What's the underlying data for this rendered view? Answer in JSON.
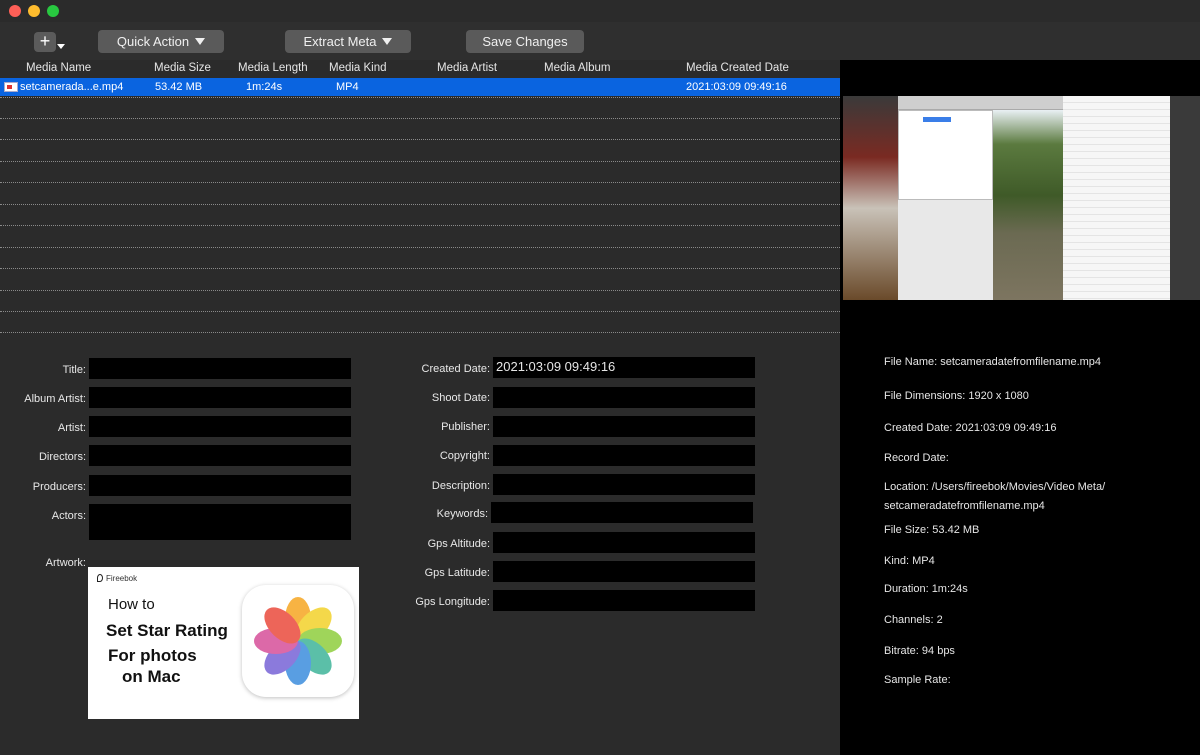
{
  "toolbar": {
    "add_label": "+",
    "quick_action": "Quick Action",
    "extract_meta": "Extract Meta",
    "save_changes": "Save Changes"
  },
  "table": {
    "headers": [
      "Media Name",
      "Media Size",
      "Media Length",
      "Media Kind",
      "Media Artist",
      "Media Album",
      "Media Created Date"
    ],
    "rows": [
      {
        "name": "setcamerada...e.mp4",
        "size": "53.42 MB",
        "length": "1m:24s",
        "kind": "MP4",
        "artist": "",
        "album": "",
        "created": "2021:03:09 09:49:16"
      }
    ]
  },
  "form": {
    "left": [
      {
        "label": "Title:",
        "value": ""
      },
      {
        "label": "Album Artist:",
        "value": ""
      },
      {
        "label": "Artist:",
        "value": ""
      },
      {
        "label": "Directors:",
        "value": ""
      },
      {
        "label": "Producers:",
        "value": ""
      },
      {
        "label": "Actors:",
        "value": ""
      },
      {
        "label": "Artwork:",
        "value": ""
      }
    ],
    "right": [
      {
        "label": "Created Date:",
        "value": "2021:03:09 09:49:16"
      },
      {
        "label": "Shoot Date:",
        "value": ""
      },
      {
        "label": "Publisher:",
        "value": ""
      },
      {
        "label": "Copyright:",
        "value": ""
      },
      {
        "label": "Description:",
        "value": ""
      },
      {
        "label": "Keywords:",
        "value": ""
      },
      {
        "label": "Gps Altitude:",
        "value": ""
      },
      {
        "label": "Gps Latitude:",
        "value": ""
      },
      {
        "label": "Gps Longitude:",
        "value": ""
      }
    ]
  },
  "artwork": {
    "brand": "Fireebok",
    "line_how": "How to",
    "line1": "Set Star Rating",
    "line2": "For photos",
    "line3": "on Mac"
  },
  "info": {
    "file_name": "File Name: setcameradatefromfilename.mp4",
    "dimensions": "File Dimensions: 1920 x 1080",
    "created": "Created Date: 2021:03:09 09:49:16",
    "record": "Record Date:",
    "location1": "Location: /Users/fireebok/Movies/Video Meta/",
    "location2": "setcameradatefromfilename.mp4",
    "size": "File Size: 53.42 MB",
    "kind": "Kind: MP4",
    "duration": "Duration: 1m:24s",
    "channels": "Channels: 2",
    "bitrate": "Bitrate: 94 bps",
    "sample_rate": "Sample Rate:"
  },
  "colors": {
    "selection": "#0a64e0",
    "close": "#fe5f57",
    "minimize": "#febc2e",
    "maximize": "#28c840"
  }
}
